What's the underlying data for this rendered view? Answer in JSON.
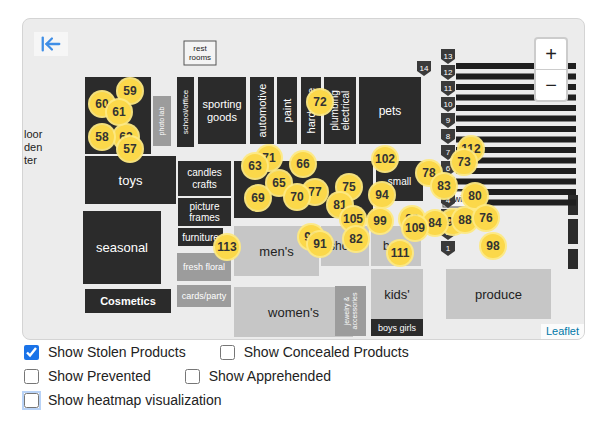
{
  "map": {
    "departments": [
      {
        "lines": [
          "rest",
          "rooms"
        ],
        "kind": "plain"
      },
      {
        "lines": [
          "photo lab"
        ],
        "kind": "mid"
      },
      {
        "lines": [
          "school/office"
        ],
        "kind": "dark"
      },
      {
        "lines": [
          "sporting",
          "goods"
        ],
        "kind": "dark"
      },
      {
        "lines": [
          "automotive"
        ],
        "kind": "dark"
      },
      {
        "lines": [
          "paint"
        ],
        "kind": "dark"
      },
      {
        "lines": [
          "hardware"
        ],
        "kind": "dark"
      },
      {
        "lines": [
          "plumbing",
          "electrical"
        ],
        "kind": "dark"
      },
      {
        "lines": [
          "pets"
        ],
        "kind": "dark"
      },
      {
        "lines": [
          "toys"
        ],
        "kind": "dark"
      },
      {
        "lines": [
          "candles",
          "crafts"
        ],
        "kind": "dark"
      },
      {
        "lines": [
          "picture",
          "frames"
        ],
        "kind": "dark"
      },
      {
        "lines": [
          "furniture"
        ],
        "kind": "dark"
      },
      {
        "lines": [
          "small"
        ],
        "kind": "dark"
      },
      {
        "lines": [
          "seasonal"
        ],
        "kind": "dark"
      },
      {
        "lines": [
          "men's"
        ],
        "kind": "light"
      },
      {
        "lines": [
          "shoes"
        ],
        "kind": "light"
      },
      {
        "lines": [
          "baby"
        ],
        "kind": "light"
      },
      {
        "lines": [
          "fresh floral"
        ],
        "kind": "mid"
      },
      {
        "lines": [
          "cards/party"
        ],
        "kind": "mid"
      },
      {
        "lines": [
          "Cosmetics"
        ],
        "kind": "dark"
      },
      {
        "lines": [
          "women's"
        ],
        "kind": "light"
      },
      {
        "lines": [
          "jewelry &",
          "accessories"
        ],
        "kind": "mid"
      },
      {
        "lines": [
          "kids'"
        ],
        "kind": "light"
      },
      {
        "lines": [
          "boys girls"
        ],
        "kind": "dark"
      },
      {
        "lines": [
          "produce"
        ],
        "kind": "light"
      },
      {
        "lines": [
          "wine"
        ],
        "kind": "plain"
      },
      {
        "lines": [
          "loor",
          "den",
          "ter"
        ],
        "kind": "plain"
      }
    ],
    "lanes": [
      "14",
      "13",
      "12",
      "11",
      "10",
      "9",
      "8",
      "7",
      "6",
      "5",
      "4",
      "3",
      "2",
      "1"
    ],
    "pins": [
      "62",
      "60",
      "59",
      "61",
      "58",
      "57",
      "72",
      "71",
      "63",
      "66",
      "65",
      "69",
      "77",
      "70",
      "75",
      "81",
      "102",
      "112",
      "73",
      "78",
      "83",
      "94",
      "89",
      "105",
      "99",
      "90",
      "84",
      "109",
      "88",
      "80",
      "76",
      "113",
      "92",
      "91",
      "82",
      "111",
      "98"
    ],
    "zoom": {
      "in": "+",
      "out": "−"
    },
    "attribution": "Leaflet"
  },
  "control_rows": [
    {
      "items": [
        {
          "label": "Show Stolen Products",
          "checked": true,
          "focused": false
        },
        {
          "label": "Show Concealed Products",
          "checked": false,
          "focused": false
        }
      ]
    },
    {
      "items": [
        {
          "label": "Show Prevented",
          "checked": false,
          "focused": false
        },
        {
          "label": "Show Apprehended",
          "checked": false,
          "focused": false
        }
      ]
    },
    {
      "items": [
        {
          "label": "Show heatmap visualization",
          "checked": false,
          "focused": true
        }
      ]
    }
  ]
}
